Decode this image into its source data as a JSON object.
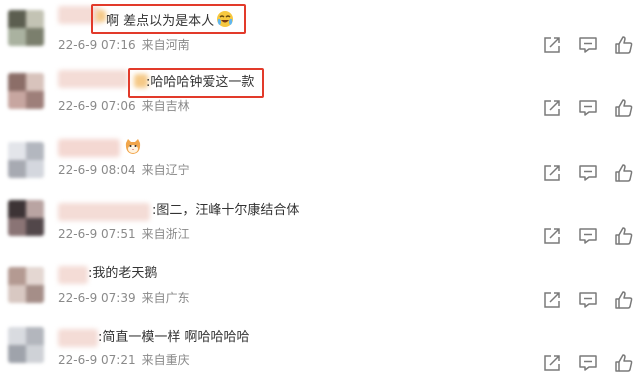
{
  "comments": [
    {
      "text": "啊 差点以为是本人",
      "emoji": "crying-laughing-emoji",
      "date": "22-6-9 07:16",
      "source": "来自河南"
    },
    {
      "text": ":哈哈哈钟爱这一款",
      "date": "22-6-9 07:06",
      "source": "来自吉林"
    },
    {
      "text": "",
      "emoji": "cat-emoji",
      "date": "22-6-9 08:04",
      "source": "来自辽宁"
    },
    {
      "text": ":图二，汪峰十尔康结合体",
      "date": "22-6-9 07:51",
      "source": "来自浙江"
    },
    {
      "text": ":我的老天鹅",
      "date": "22-6-9 07:39",
      "source": "来自广东"
    },
    {
      "text": ":简直一模一样  啊哈哈哈哈",
      "date": "22-6-9 07:21",
      "source": "来自重庆"
    }
  ],
  "actions": [
    "share-icon",
    "comment-icon",
    "like-icon"
  ],
  "colors": {
    "highlight": "#e23a2a",
    "meta": "#8a8a8a",
    "icon": "#7a7a7a"
  }
}
